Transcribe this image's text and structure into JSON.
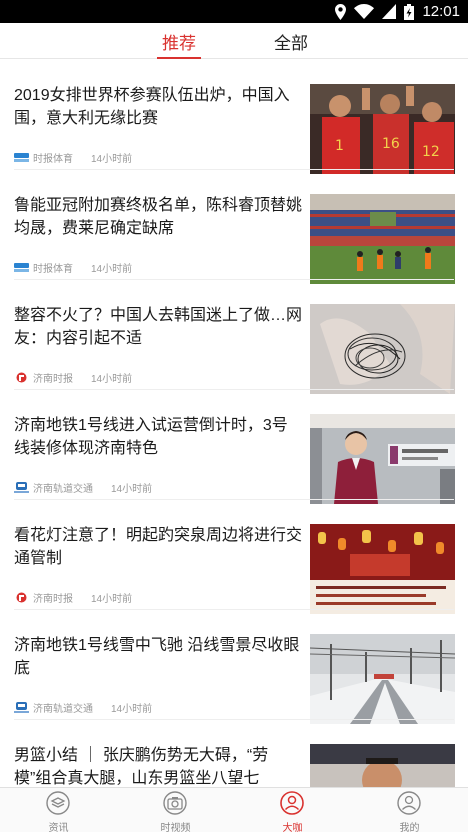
{
  "status_bar": {
    "time": "12:01",
    "icons": [
      "location-icon",
      "wifi-icon",
      "signal-icon",
      "battery-icon"
    ]
  },
  "tabs": [
    {
      "label": "推荐",
      "active": true
    },
    {
      "label": "全部",
      "active": false
    }
  ],
  "feed": [
    {
      "title": "2019女排世界杯参赛队伍出炉，中国入围，意大利无缘比赛",
      "source": "时报体育",
      "time": "14小时前",
      "thumb": "volleyball-players-photo"
    },
    {
      "title": "鲁能亚冠附加赛终极名单，陈科睿顶替姚均晟，费莱尼确定缺席",
      "source": "时报体育",
      "time": "14小时前",
      "thumb": "football-stadium-photo"
    },
    {
      "title": "整容不火了？中国人去韩国迷上了做…网友：内容引起不适",
      "source": "济南时报",
      "time": "14小时前",
      "thumb": "hair-in-hand-photo"
    },
    {
      "title": "济南地铁1号线进入试运营倒计时，3号线装修体现济南特色",
      "source": "济南轨道交通",
      "time": "14小时前",
      "thumb": "metro-attendant-photo"
    },
    {
      "title": "看花灯注意了！明起趵突泉周边将进行交通管制",
      "source": "济南时报",
      "time": "14小时前",
      "thumb": "lantern-notice-photo"
    },
    {
      "title": "济南地铁1号线雪中飞驰  沿线雪景尽收眼底",
      "source": "济南轨道交通",
      "time": "14小时前",
      "thumb": "snowy-railway-photo"
    },
    {
      "title": "男篮小结 ｜ 张庆鹏伤势无大碍，“劳模”组合真大腿，山东男篮坐八望七",
      "source": "",
      "time": "",
      "thumb": "basketball-player-photo"
    }
  ],
  "bottom_nav": [
    {
      "label": "资讯",
      "icon": "news-icon",
      "active": false
    },
    {
      "label": "时视频",
      "icon": "camera-icon",
      "active": false
    },
    {
      "label": "大咖",
      "icon": "star-user-icon",
      "active": true
    },
    {
      "label": "我的",
      "icon": "profile-icon",
      "active": false
    }
  ],
  "colors": {
    "accent": "#d9322f",
    "text": "#1a1a1a",
    "meta": "#999999"
  }
}
